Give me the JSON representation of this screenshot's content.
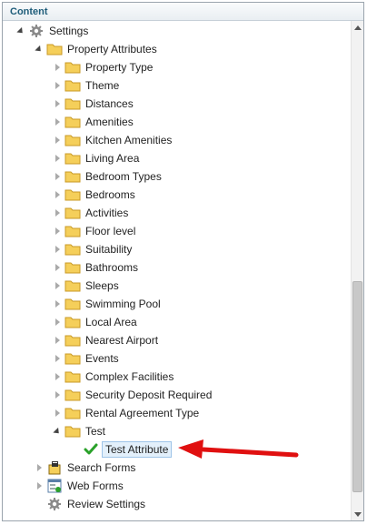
{
  "panel": {
    "title": "Content"
  },
  "tree": {
    "settings": {
      "label": "Settings",
      "icon": "gear-icon"
    },
    "property_attributes": {
      "label": "Property Attributes",
      "icon": "folder-icon"
    },
    "attributes": [
      "Property Type",
      "Theme",
      "Distances",
      "Amenities",
      "Kitchen Amenities",
      "Living Area",
      "Bedroom Types",
      "Bedrooms",
      "Activities",
      "Floor level",
      "Suitability",
      "Bathrooms",
      "Sleeps",
      "Swimming Pool",
      "Local Area",
      "Nearest Airport",
      "Events",
      "Complex Facilities",
      "Security Deposit Required",
      "Rental Agreement Type"
    ],
    "test": {
      "label": "Test",
      "icon": "folder-icon"
    },
    "test_attribute": {
      "label": "Test Attribute",
      "icon": "checkmark-icon"
    },
    "search_forms": {
      "label": "Search Forms",
      "icon": "search-forms-icon"
    },
    "web_forms": {
      "label": "Web Forms",
      "icon": "web-forms-icon"
    },
    "review_settings": {
      "label": "Review Settings",
      "icon": "gear-icon"
    }
  },
  "colors": {
    "header_text": "#1f5d7a",
    "folder": "#f0c64d",
    "check": "#2aa12a",
    "selection_bg": "#e3f0fb",
    "annotation_arrow": "#e01010"
  }
}
